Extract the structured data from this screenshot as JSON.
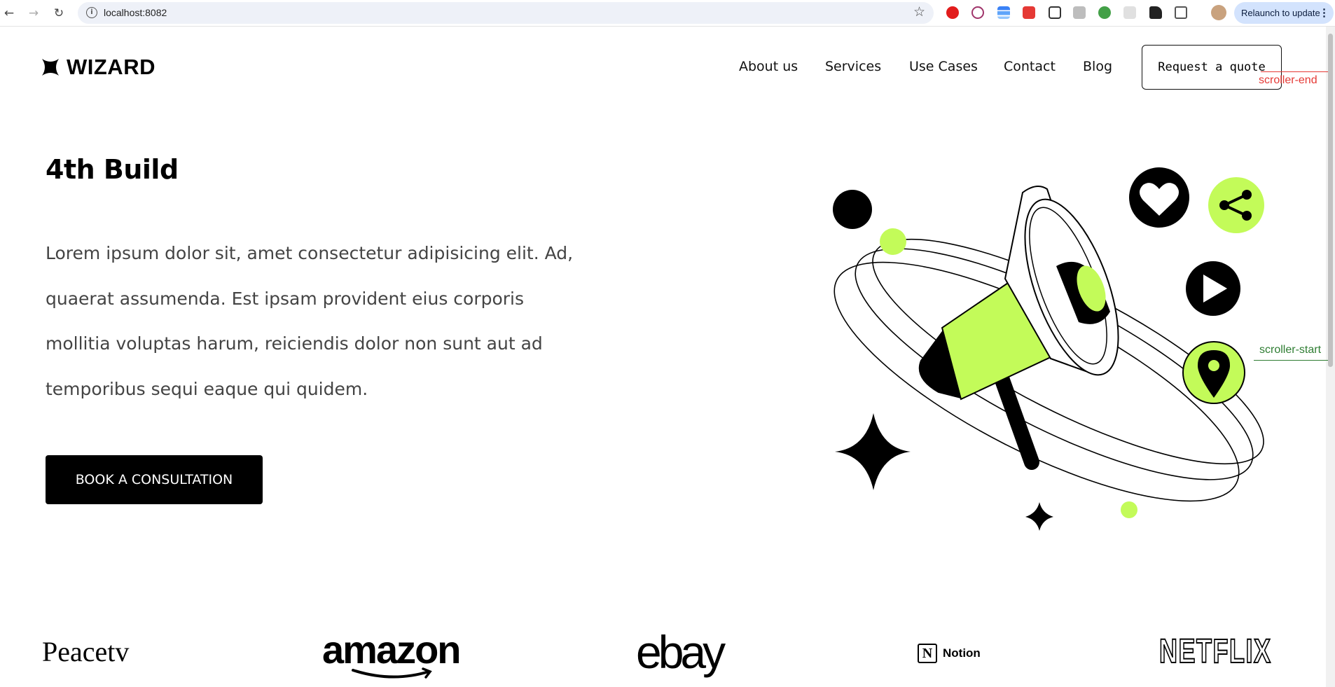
{
  "browser": {
    "url": "localhost:8082",
    "relaunch_label": "Relaunch to update"
  },
  "header": {
    "logo_text": "WIZARD",
    "nav": [
      "About us",
      "Services",
      "Use Cases",
      "Contact",
      "Blog"
    ],
    "quote_button": "Request a quote"
  },
  "debug": {
    "scroller_end": "scroller-end",
    "scroller_start": "scroller-start"
  },
  "hero": {
    "title": "4th Build",
    "text": "Lorem ipsum dolor sit, amet consectetur adipisicing elit. Ad, quaerat assumenda. Est ipsam provident eius corporis mollitia voluptas harum, reiciendis dolor non sunt aut ad temporibus sequi eaque qui quidem.",
    "cta": "BOOK A CONSULTATION"
  },
  "brands": {
    "peacetv": "Peacetv",
    "amazon": "amazon",
    "ebay": "ebay",
    "notion": "Notion",
    "netflix": "NETFLIX"
  },
  "colors": {
    "accent": "#c3fb59",
    "black": "#000000"
  }
}
